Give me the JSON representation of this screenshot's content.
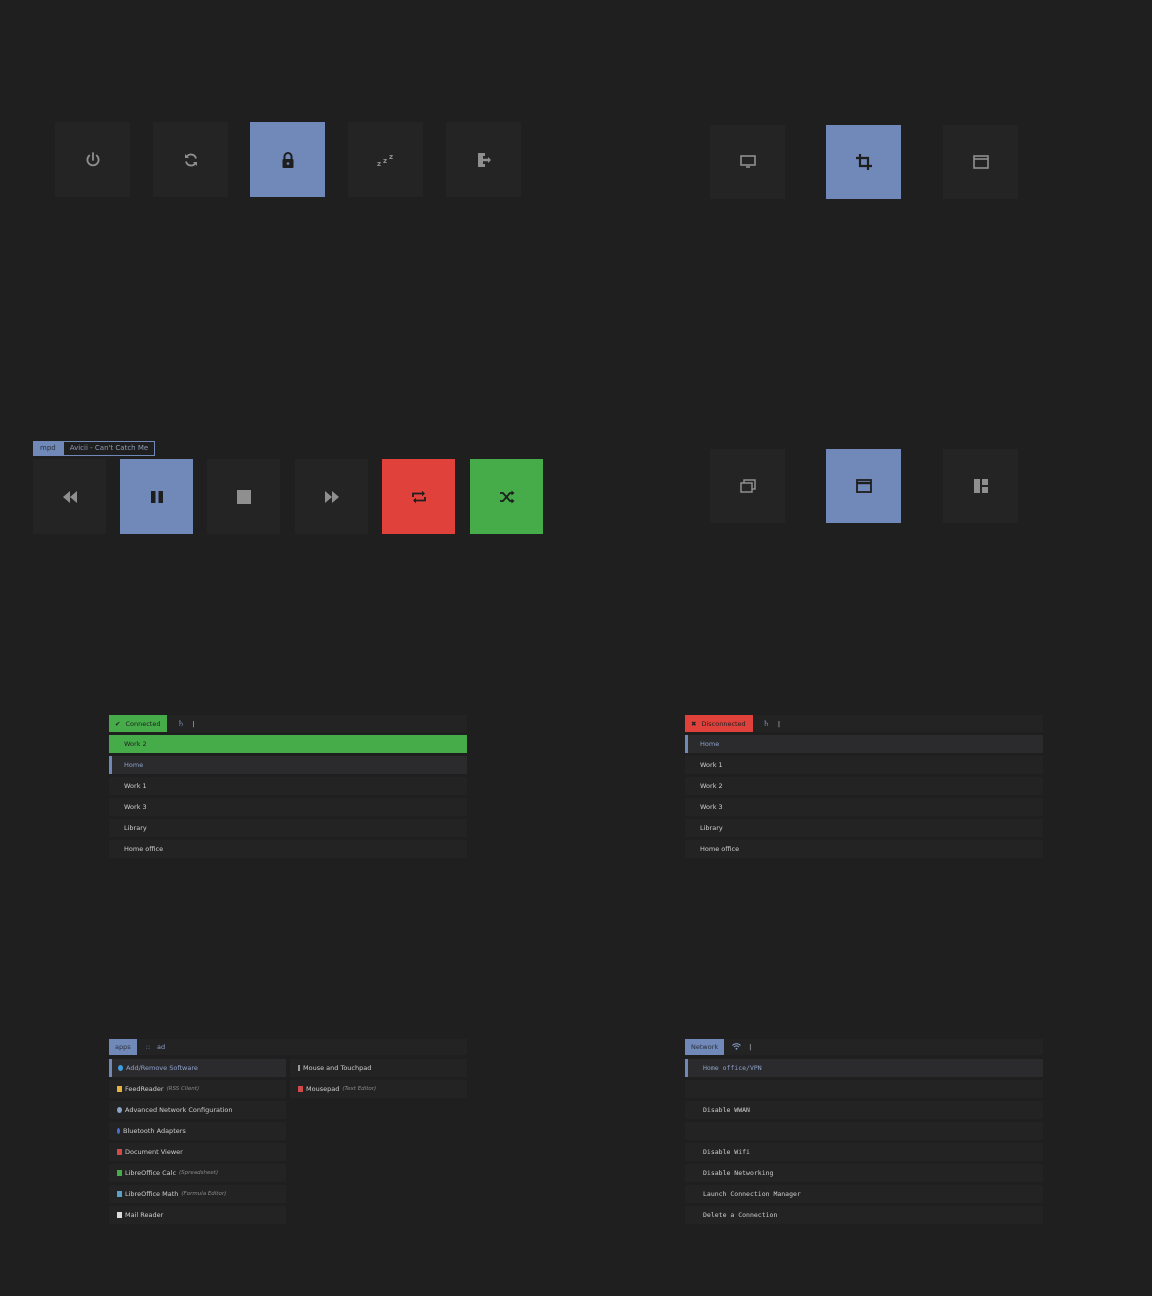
{
  "colors": {
    "background": "#1f1f20",
    "tile": "#242425",
    "accent_blue": "#7089b8",
    "red": "#e0413b",
    "green": "#46ac4a"
  },
  "power_menu": {
    "buttons": [
      {
        "icon": "power-icon",
        "selected": false
      },
      {
        "icon": "reboot-icon",
        "selected": false
      },
      {
        "icon": "lock-icon",
        "selected": true
      },
      {
        "icon": "sleep-icon",
        "selected": false
      },
      {
        "icon": "logout-icon",
        "selected": false
      }
    ]
  },
  "screenshot_menu": {
    "buttons": [
      {
        "icon": "monitor-icon",
        "selected": false
      },
      {
        "icon": "crop-icon",
        "selected": true
      },
      {
        "icon": "window-icon",
        "selected": false
      }
    ]
  },
  "mpd": {
    "tag": "mpd",
    "now_playing": "Avicii - Can't Catch Me",
    "buttons": [
      {
        "icon": "previous-icon",
        "state": "normal"
      },
      {
        "icon": "pause-icon",
        "state": "selected"
      },
      {
        "icon": "stop-icon",
        "state": "normal"
      },
      {
        "icon": "next-icon",
        "state": "normal"
      },
      {
        "icon": "repeat-icon",
        "state": "off"
      },
      {
        "icon": "shuffle-icon",
        "state": "on"
      }
    ]
  },
  "window_menu": {
    "buttons": [
      {
        "icon": "windows-stack-icon",
        "selected": false
      },
      {
        "icon": "window-icon",
        "selected": true
      },
      {
        "icon": "tiling-layout-icon",
        "selected": false
      }
    ]
  },
  "vpn_connected": {
    "status": "Connected",
    "items": [
      "Work 2",
      "Home",
      "Work 1",
      "Work 3",
      "Library",
      "Home office"
    ]
  },
  "vpn_disconnected": {
    "status": "Disconnected",
    "items": [
      "Home",
      "Work 1",
      "Work 2",
      "Work 3",
      "Library",
      "Home office"
    ]
  },
  "apps": {
    "tag": "apps",
    "separator": "::",
    "query": "ad",
    "left_column": [
      {
        "name": "Add/Remove Software",
        "sub": "",
        "icon_color": "#3d9de0"
      },
      {
        "name": "FeedReader",
        "sub": "(RSS Client)",
        "icon_color": "#e8b33a"
      },
      {
        "name": "Advanced Network Configuration",
        "sub": "",
        "icon_color": "#8aa3c8"
      },
      {
        "name": "Bluetooth Adapters",
        "sub": "",
        "icon_color": "#4a6fd0"
      },
      {
        "name": "Document Viewer",
        "sub": "",
        "icon_color": "#d04a4a"
      },
      {
        "name": "LibreOffice Calc",
        "sub": "(Spreadsheet)",
        "icon_color": "#46ac4a"
      },
      {
        "name": "LibreOffice Math",
        "sub": "(Formula Editor)",
        "icon_color": "#5aa0c8"
      },
      {
        "name": "Mail Reader",
        "sub": "",
        "icon_color": "#dcdcdc"
      }
    ],
    "right_column": [
      {
        "name": "Mouse and Touchpad",
        "sub": "",
        "icon_color": "#9a9a9a"
      },
      {
        "name": "Mousepad",
        "sub": "(Text Editor)",
        "icon_color": "#d04a4a"
      }
    ]
  },
  "network": {
    "tag": "Network",
    "items": [
      "Home office/VPN",
      "",
      "Disable WWAN",
      "",
      "Disable Wifi",
      "Disable Networking",
      "Launch Connection Manager",
      "Delete a Connection"
    ]
  }
}
